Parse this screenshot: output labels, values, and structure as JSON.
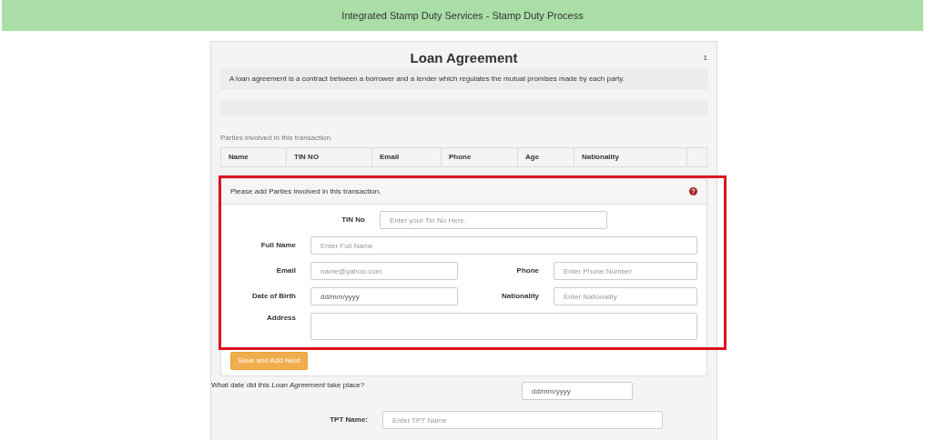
{
  "header": {
    "title": "Integrated Stamp Duty Services - Stamp Duty Process"
  },
  "card": {
    "title": "Loan Agreement",
    "page_number": "1",
    "description": "A loan agreement is a contract between a borrower and a lender which regulates the mutual promises made by each party."
  },
  "parties": {
    "caption": "Parties involved in this transaction.",
    "columns": [
      "Name",
      "TIN NO",
      "Email",
      "Phone",
      "Age",
      "Nationality"
    ]
  },
  "party_form": {
    "heading": "Please add Parties involved in this transaction.",
    "highlighted": true,
    "tin": {
      "label": "TIN No",
      "placeholder": "Enter your Tin No Here."
    },
    "full_name": {
      "label": "Full Name",
      "placeholder": "Enter Full Name"
    },
    "email": {
      "label": "Email",
      "placeholder": "name@yahoo.com"
    },
    "phone": {
      "label": "Phone",
      "placeholder": "Enter Phone Number"
    },
    "dob": {
      "label": "Date of Birth",
      "value": "dd/mm/yyyy"
    },
    "nationality": {
      "label": "Nationality",
      "placeholder": "Enter Nationality"
    },
    "address": {
      "label": "Address"
    },
    "button": "Save and Add Next"
  },
  "date_question": {
    "text": "What date did this *Loan Agreement* take place?",
    "value": "dd/mm/yyyy"
  },
  "tpt": {
    "label": "TPT Name:",
    "placeholder": "Enter TPT Name"
  }
}
